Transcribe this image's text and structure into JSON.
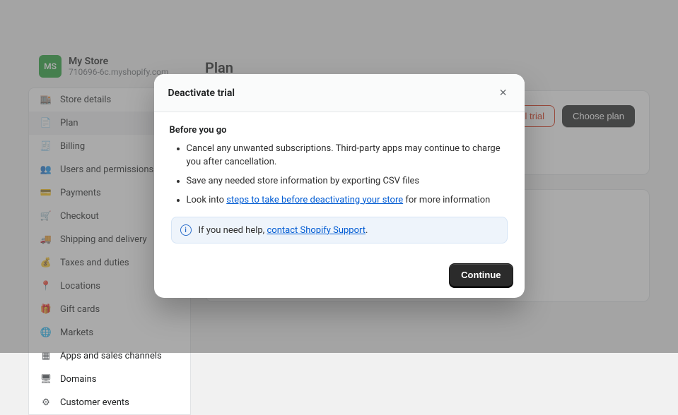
{
  "store": {
    "initials": "MS",
    "name": "My Store",
    "sub": "710696-6c.myshopify.com"
  },
  "page": {
    "title": "Plan"
  },
  "sidebar": {
    "items": [
      {
        "label": "Store details"
      },
      {
        "label": "Plan"
      },
      {
        "label": "Billing"
      },
      {
        "label": "Users and permissions"
      },
      {
        "label": "Payments"
      },
      {
        "label": "Checkout"
      },
      {
        "label": "Shipping and delivery"
      },
      {
        "label": "Taxes and duties"
      },
      {
        "label": "Locations"
      },
      {
        "label": "Gift cards"
      },
      {
        "label": "Markets"
      },
      {
        "label": "Apps and sales channels"
      },
      {
        "label": "Domains"
      },
      {
        "label": "Customer events"
      }
    ]
  },
  "card": {
    "cancel": "Cancel trial",
    "choose": "Choose plan"
  },
  "modal": {
    "title": "Deactivate trial",
    "subtitle": "Before you go",
    "bullets": {
      "b1": "Cancel any unwanted subscriptions. Third-party apps may continue to charge you after cancellation.",
      "b2": "Save any needed store information by exporting CSV files",
      "b3_pre": "Look into ",
      "b3_link": "steps to take before deactivating your store",
      "b3_post": " for more information"
    },
    "banner": {
      "pre": "If you need help, ",
      "link": "contact Shopify Support",
      "post": "."
    },
    "continue": "Continue"
  }
}
